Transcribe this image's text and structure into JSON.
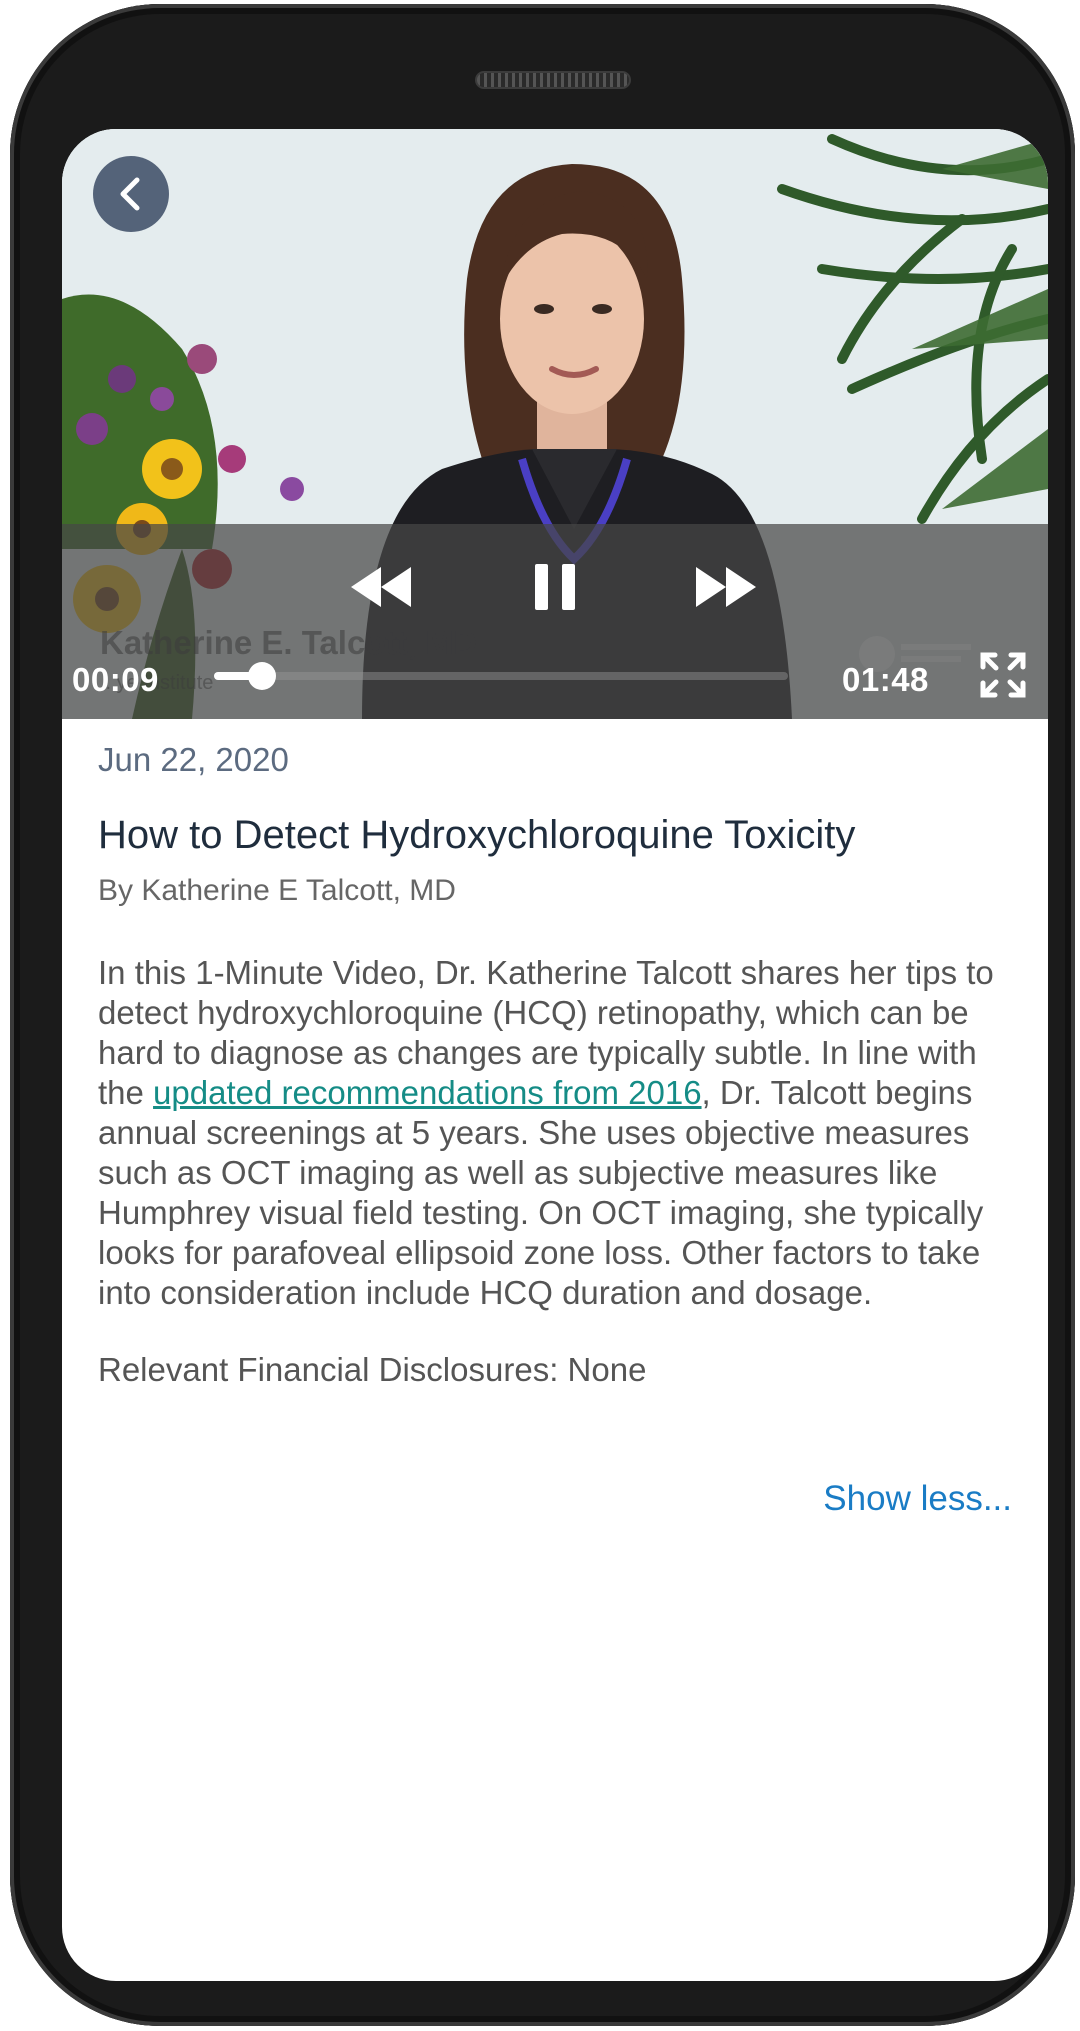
{
  "video": {
    "current_time": "00:09",
    "total_time": "01:48",
    "progress_fraction": 0.083,
    "overlay_name": "Katherine E. Talcott, MD",
    "overlay_subtitle": "...ye Institute"
  },
  "article": {
    "date": "Jun 22, 2020",
    "title": "How to Detect Hydroxychloroquine Toxicity",
    "author": "By Katherine E Talcott, MD",
    "body_part1": "In this 1-Minute Video, Dr. Katherine Talcott shares her tips to detect hydroxychloroquine (HCQ) retinopathy, which can be hard to diagnose as changes are typically subtle. In line with the ",
    "body_link": "updated recommendations from 2016",
    "body_part2": ", Dr. Talcott begins annual screenings at 5 years. She uses objective measures such as OCT imaging as well as subjective measures like Humphrey visual field testing. On OCT imaging, she typically looks for parafoveal ellipsoid zone loss. Other factors to take into consideration include HCQ duration and dosage.",
    "disclosure": "Relevant Financial Disclosures: None",
    "show_less": "Show less..."
  },
  "colors": {
    "link": "#158c86",
    "show_less": "#1a7cc5",
    "back_button": "#546379"
  },
  "icons": {
    "back": "chevron-left-icon",
    "rewind": "rewind-icon",
    "pause": "pause-icon",
    "fast_forward": "fast-forward-icon",
    "fullscreen": "fullscreen-icon"
  }
}
